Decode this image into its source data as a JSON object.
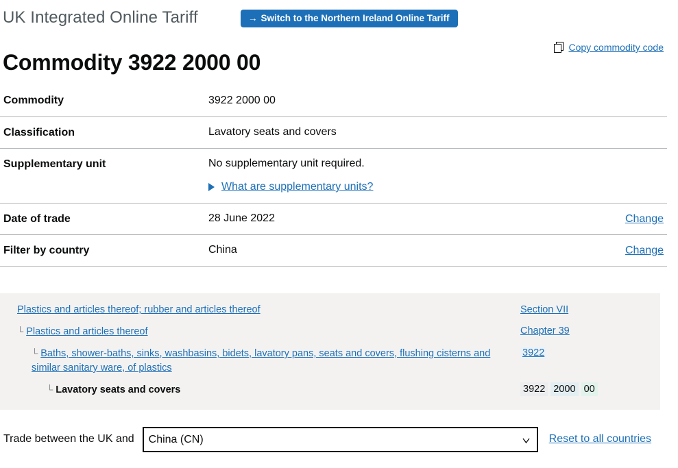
{
  "header": {
    "service_name": "UK Integrated Online Tariff",
    "switch_button": {
      "arrow": "→",
      "label": "Switch to the Northern Ireland Online Tariff"
    },
    "page_title": "Commodity 3922 2000 00",
    "copy_link": "Copy commodity code",
    "copy_icon": "copy-icon"
  },
  "details": {
    "rows": [
      {
        "term": "Commodity",
        "value": "3922 2000 00",
        "action": ""
      },
      {
        "term": "Classification",
        "value": "Lavatory seats and covers",
        "action": ""
      },
      {
        "term": "Supplementary unit",
        "value": "No supplementary unit required.",
        "disclosure_label": "What are supplementary units?",
        "action": ""
      },
      {
        "term": "Date of trade",
        "value": "28 June 2022",
        "action": "Change"
      },
      {
        "term": "Filter by country",
        "value": "China",
        "action": "Change"
      }
    ]
  },
  "hierarchy": {
    "connector": "└",
    "rows": [
      {
        "label": "Plastics and articles thereof; rubber and articles thereof",
        "code": "Section VII"
      },
      {
        "label": "Plastics and articles thereof",
        "code": "Chapter 39"
      },
      {
        "label": "Baths, shower-baths, sinks, washbasins, bidets, lavatory pans, seats and covers, flushing cisterns and similar sanitary ware, of plastics",
        "code": "3922"
      },
      {
        "label": "Lavatory seats and covers",
        "code_segments": [
          "3922",
          "2000",
          "00"
        ]
      }
    ]
  },
  "trade": {
    "label": "Trade between the UK and",
    "selected_country": "China (CN)",
    "reset_link": "Reset to all countries",
    "chevron_icon": "chevron-down-icon"
  },
  "colors": {
    "brand_blue": "#1d70b8",
    "panel_grey": "#f3f2f1",
    "text": "#0b0c0c",
    "muted_text": "#505a5f",
    "rule": "#b1b4b6"
  }
}
